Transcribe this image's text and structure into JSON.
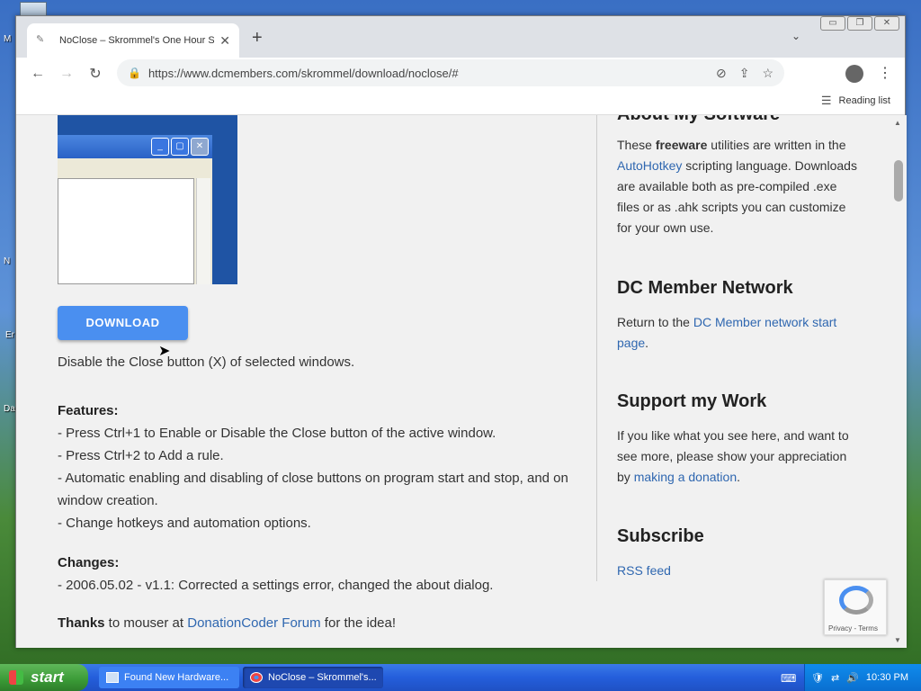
{
  "desktop": {
    "labels": [
      {
        "text": "M"
      },
      {
        "text": "N"
      },
      {
        "text": "Er"
      },
      {
        "text": "Da"
      }
    ]
  },
  "browser": {
    "tab": {
      "title": "NoClose – Skrommel's One Hour So",
      "favicon": "feather-icon"
    },
    "new_tab": "+",
    "url": "https://www.dcmembers.com/skrommel/download/noclose/#",
    "reading_list": "Reading list"
  },
  "page": {
    "download_label": "DOWNLOAD",
    "description": "Disable the Close button (X) of selected windows.",
    "features_heading": "Features:",
    "features": [
      "- Press Ctrl+1 to Enable or Disable the Close button of the active window.",
      "- Press Ctrl+2 to Add a rule.",
      "- Automatic enabling and disabling of close buttons on program start and stop, and on window creation.",
      "- Change hotkeys and automation options."
    ],
    "changes_heading": "Changes:",
    "changes": [
      "- 2006.05.02 - v1.1: Corrected a settings error, changed the about dialog."
    ],
    "thanks": {
      "bold": "Thanks",
      "pre": " to mouser at ",
      "link": "DonationCoder Forum",
      "post": " for the idea!"
    }
  },
  "sidebar": {
    "about_heading": "About My Software",
    "about": {
      "p1": "These ",
      "bold": "freeware",
      "p2": " utilities are written in the ",
      "link": "AutoHotkey",
      "p3": " scripting language. Downloads are available both as pre-compiled .exe files or as .ahk scripts you can customize for your own use."
    },
    "network_heading": "DC Member Network",
    "network": {
      "pre": "Return to the ",
      "link": "DC Member network start page",
      "post": "."
    },
    "support_heading": "Support my Work",
    "support": {
      "pre": "If you like what you see here, and want to see more, please show your appreciation by ",
      "link": "making a donation",
      "post": "."
    },
    "subscribe_heading": "Subscribe",
    "rss": "RSS feed"
  },
  "recaptcha": {
    "terms": "Privacy - Terms"
  },
  "taskbar": {
    "start": "start",
    "tasks": [
      {
        "label": "Found New Hardware..."
      },
      {
        "label": "NoClose – Skrommel's..."
      }
    ],
    "clock": "10:30 PM"
  },
  "colors": {
    "link": "#2f67b0",
    "download_button": "#4a8ff0",
    "page_bg": "#f1f1f1"
  }
}
